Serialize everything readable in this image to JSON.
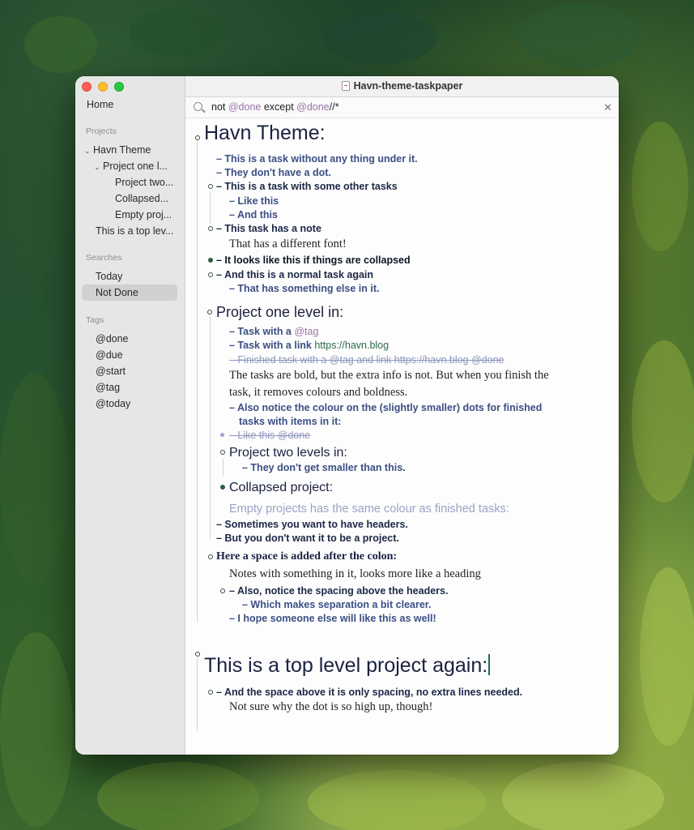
{
  "window": {
    "title": "Havn-theme-taskpaper"
  },
  "sidebar": {
    "home": "Home",
    "projects_header": "Projects",
    "projects": [
      {
        "label": "Havn Theme"
      },
      {
        "label": "Project one l..."
      },
      {
        "label": "Project two..."
      },
      {
        "label": "Collapsed..."
      },
      {
        "label": "Empty proj..."
      },
      {
        "label": "This is a top lev..."
      }
    ],
    "searches_header": "Searches",
    "searches": [
      {
        "label": "Today"
      },
      {
        "label": "Not Done"
      }
    ],
    "tags_header": "Tags",
    "tags": [
      {
        "label": "@done"
      },
      {
        "label": "@due"
      },
      {
        "label": "@start"
      },
      {
        "label": "@tag"
      },
      {
        "label": "@today"
      }
    ]
  },
  "search": {
    "query_prefix": "not ",
    "query_tag1": "@done",
    "query_mid": " except ",
    "query_tag2": "@done",
    "query_suffix": "//*"
  },
  "document": {
    "project1": "Havn Theme:",
    "t1": "– This is a task without any thing under it.",
    "t2": "– They don't have a dot.",
    "t3": "– This is a task with some other tasks",
    "t3a": "– Like this",
    "t3b": "– And this",
    "t4": "– This task has a note",
    "t4_note": "That has a different font!",
    "t5": "– It looks like this if things are collapsed",
    "t6": "– And this is a normal task again",
    "t6a": "– That has something else in it.",
    "project2": "Project one level in:",
    "p2_t1": "– Task with a ",
    "p2_t1_tag": "@tag",
    "p2_t2": "– Task with a link ",
    "p2_t2_link": "https://havn.blog",
    "p2_t3": "– Finished task with a @tag and link https://havn.blog",
    "p2_t3_tag": " @done",
    "p2_note_line1": "The tasks are bold, but the extra info is not. But when you finish the",
    "p2_note_line2": "task, it removes colours and boldness.",
    "p2_t4_line1": "– Also notice the colour on the (slightly smaller) dots for finished",
    "p2_t4_line2": "tasks with items in it:",
    "p2_t5": "– Like this",
    "p2_t5_tag": " @done",
    "project3": "Project two levels in:",
    "p3_t1": "– They don't get smaller than this.",
    "project4": "Collapsed project:",
    "empty_note": "Empty projects has the same colour as finished tasks:",
    "t7": "– Sometimes you want to have headers.",
    "t8": "– But you don't want it to be a project.",
    "heading": "Here a space is added after the colon:",
    "heading_note": "Notes with something in it, looks more like a heading",
    "t9": "– Also, notice the spacing above the headers.",
    "t9a": "– Which makes separation a bit clearer.",
    "t10": "– I hope someone else will like this as well!",
    "project5": "This is a top level project again:",
    "p5_t1": "– And the space above it is only spacing, no extra lines needed.",
    "p5_note": "Not sure why the dot is so high up, though!"
  }
}
